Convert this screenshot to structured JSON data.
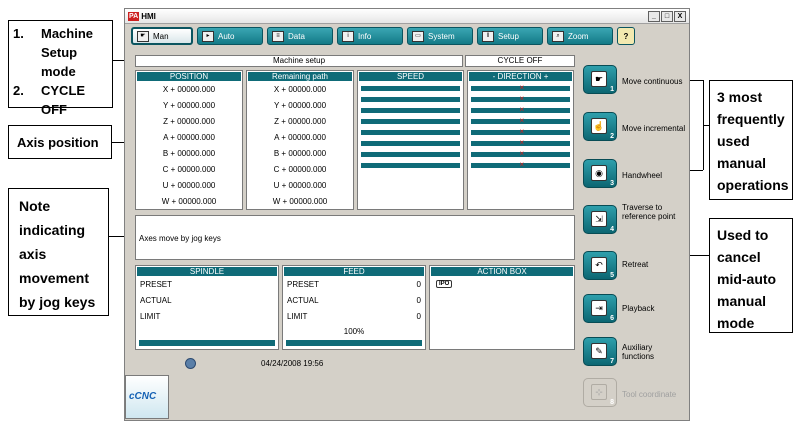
{
  "callouts": {
    "mode": {
      "item1_num": "1.",
      "item1_text": "Machine Setup mode",
      "item2_num": "2.",
      "item2_text": "CYCLE OFF"
    },
    "axis_position": "Axis position",
    "note": "Note indicating axis movement by jog keys",
    "manual_ops": "3 most frequently used manual operations",
    "cancel": "Used to cancel mid-auto manual mode"
  },
  "window": {
    "title_badge": "PA",
    "title": "HMI",
    "controls": [
      "_",
      "□",
      "X"
    ]
  },
  "toolbar": [
    {
      "label": "Man",
      "icon": "hand-icon",
      "active": true
    },
    {
      "label": "Auto",
      "icon": "auto-icon",
      "active": false
    },
    {
      "label": "Data",
      "icon": "data-icon",
      "active": false
    },
    {
      "label": "Info",
      "icon": "info-icon",
      "active": false
    },
    {
      "label": "System",
      "icon": "system-icon",
      "active": false
    },
    {
      "label": "Setup",
      "icon": "setup-icon",
      "active": false
    },
    {
      "label": "Zoom",
      "icon": "zoom-icon",
      "active": false
    },
    {
      "label": "?",
      "icon": "help-icon",
      "active": false
    }
  ],
  "status": {
    "mode": "Machine setup",
    "cycle": "CYCLE OFF"
  },
  "columns": {
    "position": "POSITION",
    "remaining": "Remaining path",
    "speed": "SPEED",
    "direction": "- DIRECTION +"
  },
  "axes": [
    {
      "position": "X + 00000.000",
      "remaining": "X + 00000.000"
    },
    {
      "position": "Y + 00000.000",
      "remaining": "Y + 00000.000"
    },
    {
      "position": "Z + 00000.000",
      "remaining": "Z + 00000.000"
    },
    {
      "position": "A + 00000.000",
      "remaining": "A + 00000.000"
    },
    {
      "position": "B + 00000.000",
      "remaining": "B + 00000.000"
    },
    {
      "position": "C + 00000.000",
      "remaining": "C + 00000.000"
    },
    {
      "position": "U + 00000.000",
      "remaining": "U + 00000.000"
    },
    {
      "position": "W + 00000.000",
      "remaining": "W + 00000.000"
    }
  ],
  "message": "Axes move by jog keys",
  "spindle": {
    "title": "SPINDLE",
    "rows": [
      "PRESET",
      "ACTUAL",
      "LIMIT"
    ]
  },
  "feed": {
    "title": "FEED",
    "rows": [
      {
        "label": "PRESET",
        "value": "0"
      },
      {
        "label": "ACTUAL",
        "value": "0"
      },
      {
        "label": "LIMIT",
        "value": "0"
      }
    ],
    "percent": "100%"
  },
  "action_box": {
    "title": "ACTION BOX",
    "badge": "IPO"
  },
  "footer": {
    "datetime": "04/24/2008 19:56",
    "logo": "cCNC"
  },
  "side_buttons": [
    {
      "label": "Move continuous",
      "num": "1",
      "enabled": true
    },
    {
      "label": "Move incremental",
      "num": "2",
      "enabled": true
    },
    {
      "label": "Handwheel",
      "num": "3",
      "enabled": true
    },
    {
      "label": "Traverse to reference point",
      "num": "4",
      "enabled": true
    },
    {
      "label": "Retreat",
      "num": "5",
      "enabled": true
    },
    {
      "label": "Playback",
      "num": "6",
      "enabled": true
    },
    {
      "label": "Auxiliary functions",
      "num": "7",
      "enabled": true
    },
    {
      "label": "Tool coordinate",
      "num": "8",
      "enabled": false
    }
  ]
}
